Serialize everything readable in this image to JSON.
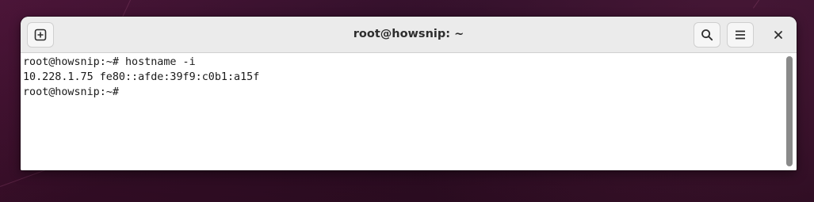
{
  "window": {
    "title": "root@howsnip: ~"
  },
  "headerbar": {
    "buttons": [
      {
        "name": "new-tab",
        "icon": "plus-square-icon"
      },
      {
        "name": "search",
        "icon": "search-icon"
      },
      {
        "name": "menu",
        "icon": "hamburger-menu-icon"
      },
      {
        "name": "close",
        "icon": "close-icon"
      }
    ]
  },
  "terminal": {
    "lines": [
      "root@howsnip:~# hostname -i",
      "10.228.1.75 fe80::afde:39f9:c0b1:a15f",
      "root@howsnip:~#"
    ]
  },
  "colors": {
    "wallpaper": "#2a0c1f",
    "headerbar": "#ebebeb",
    "terminal_bg": "#ffffff",
    "terminal_fg": "#1a1a1a",
    "scrollbar": "#8a8a8a"
  }
}
